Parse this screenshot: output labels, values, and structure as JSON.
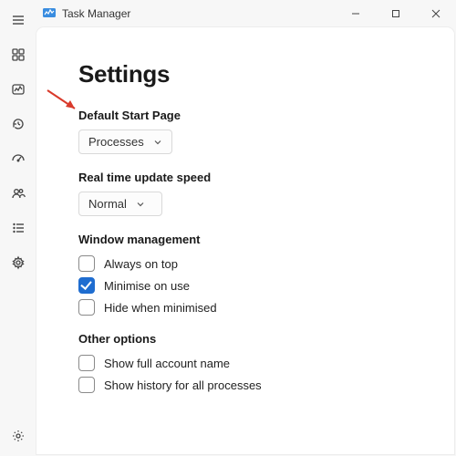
{
  "app": {
    "title": "Task Manager"
  },
  "page": {
    "title": "Settings"
  },
  "settings": {
    "default_start_page": {
      "label": "Default Start Page",
      "value": "Processes"
    },
    "realtime_update_speed": {
      "label": "Real time update speed",
      "value": "Normal"
    },
    "window_management": {
      "heading": "Window management",
      "always_on_top": {
        "label": "Always on top",
        "checked": false
      },
      "minimise_on_use": {
        "label": "Minimise on use",
        "checked": true
      },
      "hide_when_minimised": {
        "label": "Hide when minimised",
        "checked": false
      }
    },
    "other_options": {
      "heading": "Other options",
      "show_full_account_name": {
        "label": "Show full account name",
        "checked": false
      },
      "show_history_all_processes": {
        "label": "Show history for all processes",
        "checked": false
      }
    }
  },
  "sidebar": {
    "items": [
      {
        "name": "processes"
      },
      {
        "name": "performance"
      },
      {
        "name": "app-history"
      },
      {
        "name": "startup-apps"
      },
      {
        "name": "users"
      },
      {
        "name": "details"
      },
      {
        "name": "services"
      }
    ]
  }
}
